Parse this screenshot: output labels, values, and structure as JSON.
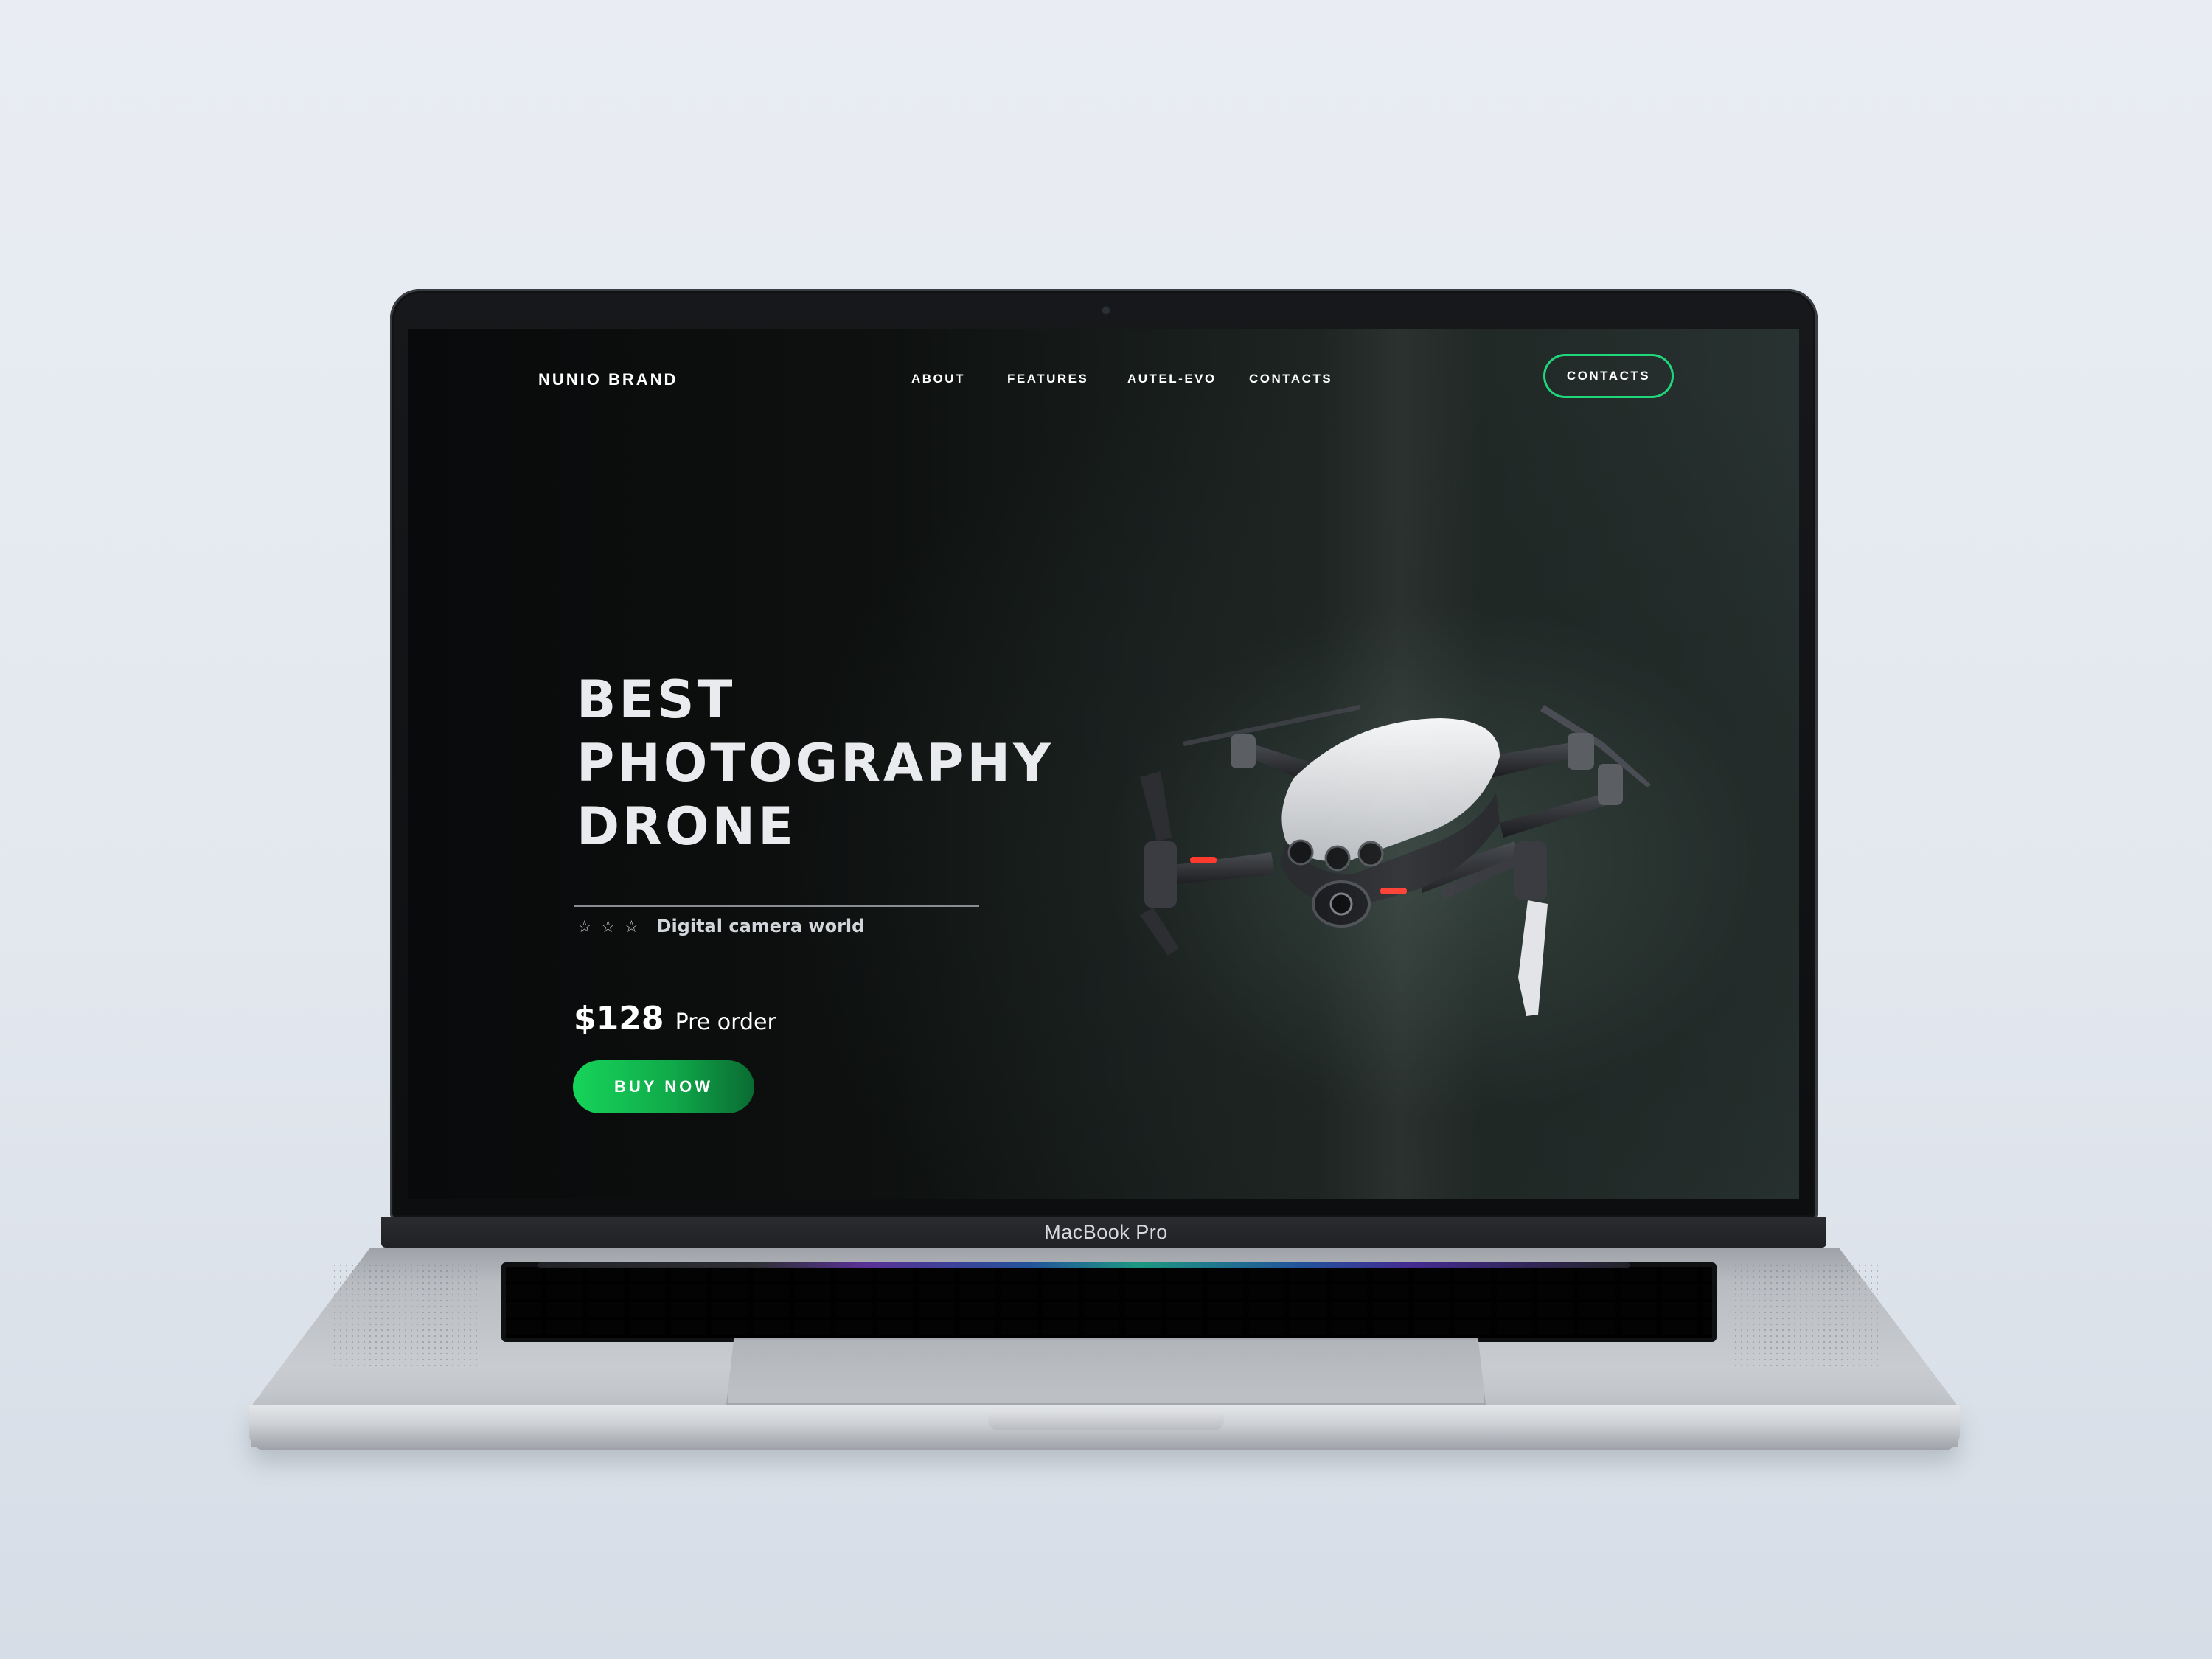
{
  "site": {
    "brand": "NUNIO BRAND",
    "nav": [
      "ABOUT",
      "FEATURES",
      "AUTEL-EVO",
      "CONTACTS"
    ],
    "cta_label": "CONTACTS"
  },
  "hero": {
    "title_lines": [
      "BEST",
      "PHOTOGRAPHY",
      "DRONE"
    ],
    "rating_stars": "☆☆☆",
    "tagline": "Digital camera world",
    "price": "$128",
    "price_note": "Pre order",
    "buy_label": "BUY NOW"
  },
  "device": {
    "model_label": "MacBook Pro"
  },
  "colors": {
    "accent_green": "#1fd67a",
    "button_green": "#16d45a",
    "screen_bg": "#0b0c0d"
  },
  "icons": [
    "drone-image",
    "star-icon"
  ]
}
